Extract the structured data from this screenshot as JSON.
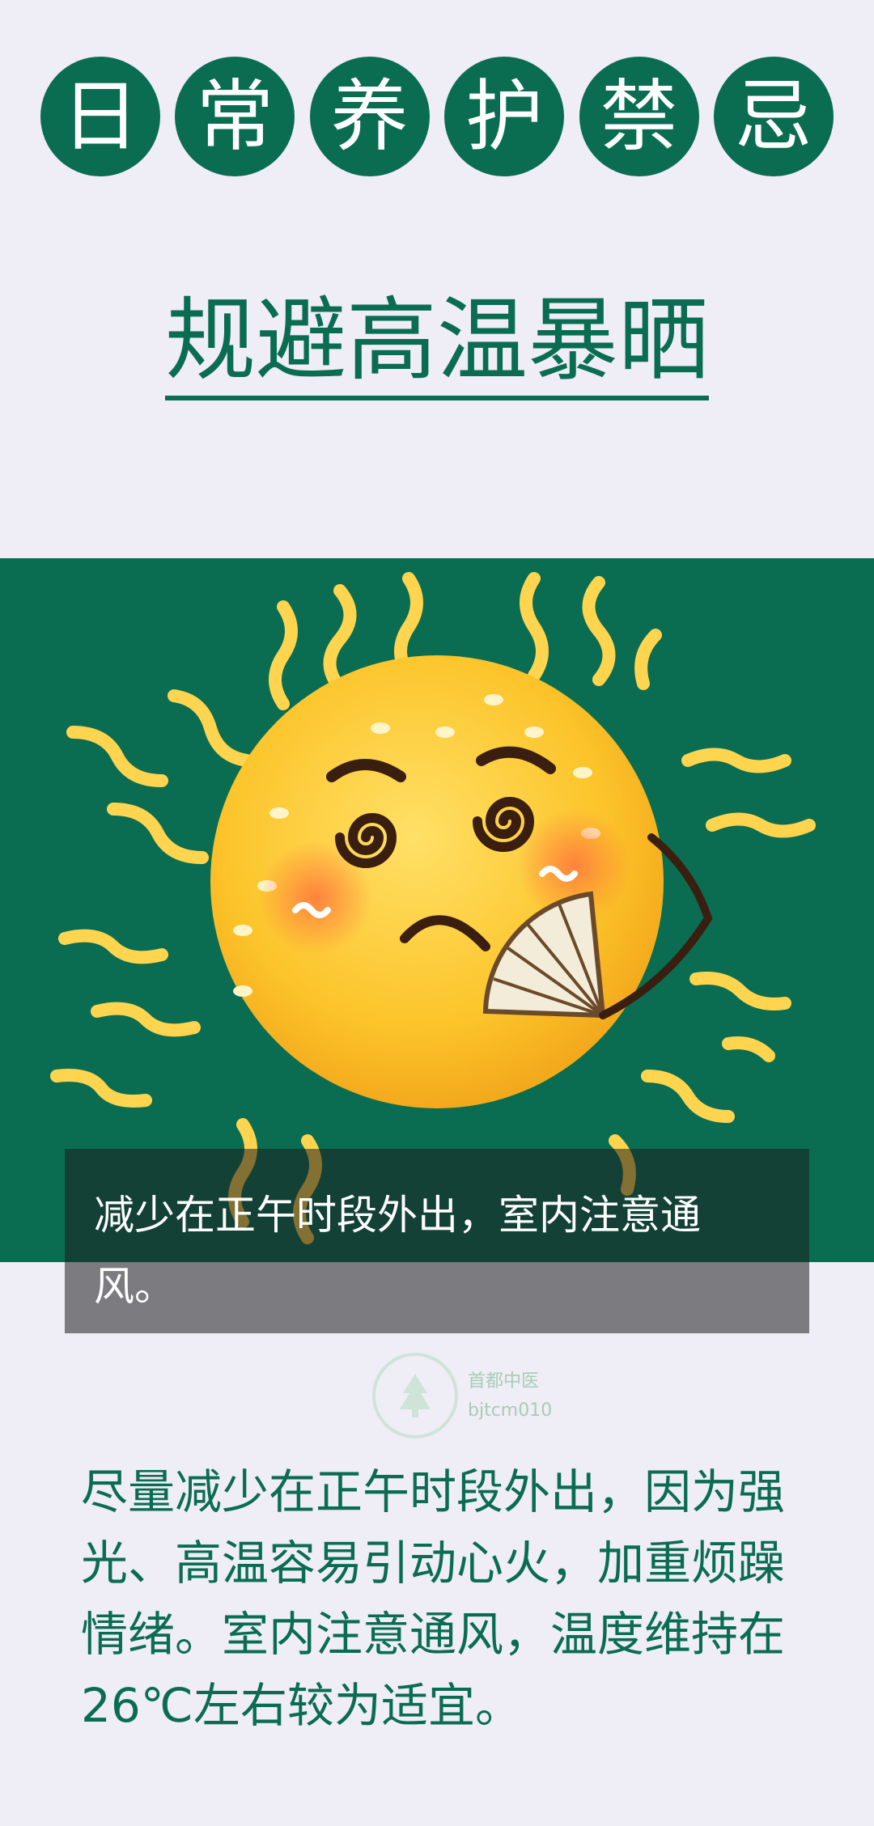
{
  "header": {
    "title_chars": [
      "日",
      "常",
      "养",
      "护",
      "禁",
      "忌"
    ],
    "subtitle": "规避高温暴晒"
  },
  "illustration": {
    "subject": "sweating-sun-with-fan",
    "colors": {
      "background": "#0a6d52",
      "sun": "#fbc02d",
      "rays": "#ffd54f"
    }
  },
  "caption": {
    "text": "减少在正午时段外出，室内注意通风。"
  },
  "logo": {
    "name": "首都中医",
    "account": "bjtcm010"
  },
  "body": {
    "text": "尽量减少在正午时段外出，因为强光、高温容易引动心火，加重烦躁情绪。室内注意通风，温度维持在26℃左右较为适宜。"
  },
  "colors": {
    "primary": "#0a6d52",
    "page_background": "#efedf5"
  }
}
